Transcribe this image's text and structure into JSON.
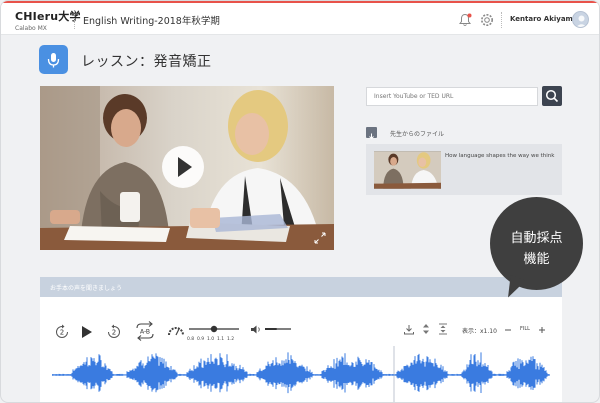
{
  "header": {
    "brand_name": "CHIeru大学",
    "brand_sub": "Calabo MX",
    "course_title": "English Writing-2018年秋学期",
    "user_name": "Kentaro Akiyama"
  },
  "lesson": {
    "title": "レッスン：発音矯正"
  },
  "video_search": {
    "placeholder": "Insert YouTube or TED URL"
  },
  "teacher_files": {
    "heading": "先生からのファイル",
    "items": [
      {
        "title": "How language shapes the way we think"
      }
    ]
  },
  "audio": {
    "section_label": "お手本の声を聞きましょう",
    "skip_back_seconds": "2",
    "skip_forward_seconds": "2",
    "loop_label": "A-B",
    "speed_ticks": [
      "0.8",
      "0.9",
      "1.0",
      "1.1",
      "1.2"
    ],
    "speed_value": 1.0,
    "volume_level": 0.45,
    "display_label": "表示：x1.10",
    "fill_label": "FILL"
  },
  "callout": {
    "line1": "自動採点",
    "line2": "機能"
  },
  "colors": {
    "accent_red": "#e8524a",
    "brand_blue": "#4a90e2",
    "waveform": "#3a7be0",
    "callout_bg": "#3f3f3f"
  },
  "icons": [
    "bell-icon",
    "gear-icon",
    "microphone-icon",
    "search-icon",
    "download-icon",
    "play-icon",
    "replay-2-icon",
    "forward-2-icon",
    "loop-ab-icon",
    "speedometer-icon",
    "volume-icon",
    "expand-icon"
  ]
}
